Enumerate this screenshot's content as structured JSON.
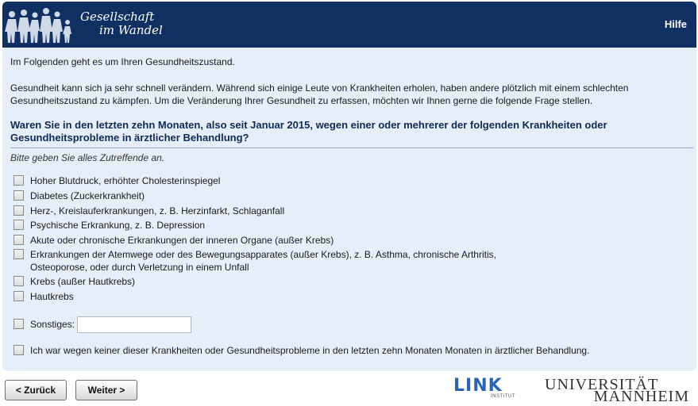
{
  "header": {
    "logo_line1": "Gesellschaft",
    "logo_line2": "im Wandel",
    "help_label": "Hilfe"
  },
  "intro": {
    "p1": "Im Folgenden geht es um Ihren Gesundheitszustand.",
    "p2": "Gesundheit kann sich ja sehr schnell verändern. Während sich einige Leute von Krankheiten erholen, haben andere plötzlich mit einem schlechten Gesundheitszustand zu kämpfen. Um die Veränderung Ihrer Gesundheit zu erfassen, möchten wir Ihnen gerne die folgende Frage stellen."
  },
  "question": "Waren Sie in den letzten zehn Monaten, also seit Januar 2015, wegen einer oder mehrerer der folgenden Krankheiten oder Gesundheitsprobleme in ärztlicher Behandlung?",
  "hint": "Bitte geben Sie alles Zutreffende an.",
  "options": [
    "Hoher Blutdruck, erhöhter Cholesterinspiegel",
    "Diabetes (Zuckerkrankheit)",
    "Herz-, Kreislauferkrankungen, z. B. Herzinfarkt, Schlaganfall",
    "Psychische Erkrankung, z. B. Depression",
    "Akute oder chronische Erkrankungen der inneren Organe (außer Krebs)",
    "Erkrankungen der Atemwege oder des Bewegungsapparates (außer Krebs), z. B. Asthma, chronische Arthritis, Osteoporose, oder durch Verletzung in einem Unfall",
    "Krebs (außer Hautkrebs)",
    "Hautkrebs"
  ],
  "other_label": "Sonstiges:",
  "other_value": "",
  "none_label": "Ich war wegen keiner dieser Krankheiten oder Gesundheitsprobleme in den letzten zehn Monaten Monaten in ärztlicher Behandlung.",
  "nav": {
    "back_label": "< Zurück",
    "next_label": "Weiter >"
  },
  "logos": {
    "link": "LINK",
    "link_sub": "INSTITUT",
    "uni_line1": "UNIVERSITÄT",
    "uni_line2": "MANNHEIM"
  },
  "colors": {
    "header_bg": "#0e3062",
    "content_bg": "#e6eefa",
    "question_text": "#0e2a57",
    "link_logo": "#2a64b8"
  }
}
